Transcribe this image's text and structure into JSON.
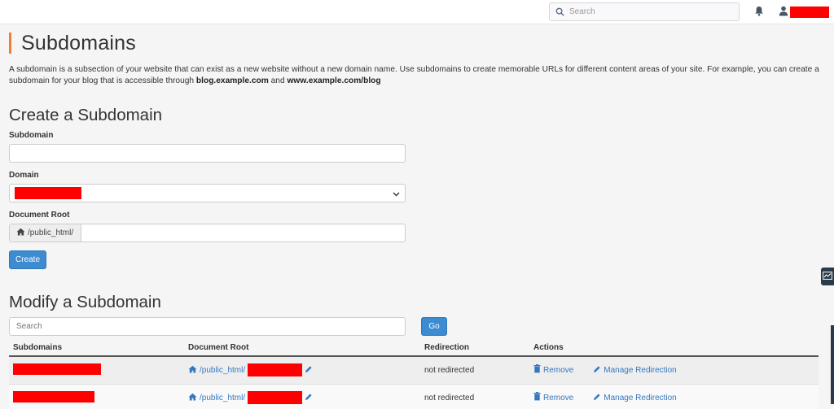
{
  "topbar": {
    "search_placeholder": "Search"
  },
  "page": {
    "title": "Subdomains",
    "description_text": "A subdomain is a subsection of your website that can exist as a new website without a new domain name. Use subdomains to create memorable URLs for different content areas of your site. For example, you can create a subdomain for your blog that is accessible through ",
    "description_example1": "blog.example.com",
    "description_and": " and ",
    "description_example2": "www.example.com/blog"
  },
  "create": {
    "heading": "Create a Subdomain",
    "subdomain_label": "Subdomain",
    "subdomain_value": "",
    "domain_label": "Domain",
    "docroot_label": "Document Root",
    "docroot_prefix": "/public_html/",
    "docroot_value": "",
    "create_button": "Create"
  },
  "modify": {
    "heading": "Modify a Subdomain",
    "search_placeholder": "Search",
    "go_button": "Go",
    "columns": [
      "Subdomains",
      "Document Root",
      "Redirection",
      "Actions"
    ],
    "rows": [
      {
        "docroot_prefix": "/public_html/",
        "redirection": "not redirected",
        "remove_label": "Remove",
        "manage_label": "Manage Redirection"
      },
      {
        "docroot_prefix": "/public_html/",
        "redirection": "not redirected",
        "remove_label": "Remove",
        "manage_label": "Manage Redirection"
      }
    ]
  },
  "colors": {
    "accent_orange": "#f07f35",
    "button_blue": "#3d8bd0",
    "link_blue": "#3578c0",
    "redaction_red": "#ff0000"
  },
  "icons": [
    "search-icon",
    "bell-icon",
    "user-icon",
    "home-icon",
    "pencil-icon",
    "trash-icon",
    "chevron-down-icon",
    "chart-icon"
  ]
}
